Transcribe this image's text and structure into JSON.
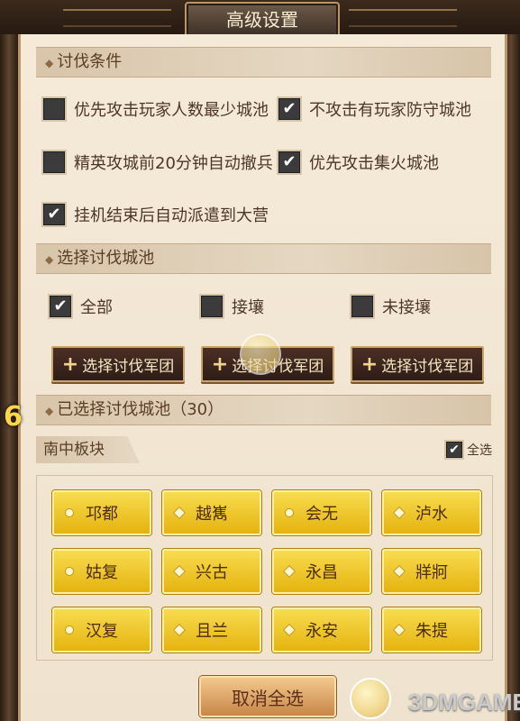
{
  "title": "高级设置",
  "sections": {
    "attack_conditions": "讨伐条件",
    "select_cities": "选择讨伐城池",
    "selected_cities": "已选择讨伐城池（30）"
  },
  "options": {
    "priority_fewest_players": {
      "label": "优先攻击玩家人数最少城池",
      "checked": false
    },
    "no_player_defended": {
      "label": "不攻击有玩家防守城池",
      "checked": true
    },
    "elite_auto_withdraw": {
      "label": "精英攻城前20分钟自动撤兵",
      "checked": false
    },
    "priority_focus_fire": {
      "label": "优先攻击集火城池",
      "checked": true
    },
    "auto_send_to_camp": {
      "label": "挂机结束后自动派遣到大营",
      "checked": true
    }
  },
  "city_filters": [
    {
      "label": "全部",
      "checked": true
    },
    {
      "label": "接壤",
      "checked": false
    },
    {
      "label": "未接壤",
      "checked": false
    }
  ],
  "army_button_label": "选择讨伐军团",
  "block": {
    "name": "南中板块",
    "select_all_label": "全选",
    "select_all_checked": true
  },
  "cities": [
    {
      "name": "邛都",
      "marker": "dot"
    },
    {
      "name": "越嶲",
      "marker": "gem"
    },
    {
      "name": "会无",
      "marker": "dot"
    },
    {
      "name": "泸水",
      "marker": "gem"
    },
    {
      "name": "姑复",
      "marker": "dot"
    },
    {
      "name": "兴古",
      "marker": "gem"
    },
    {
      "name": "永昌",
      "marker": "gem"
    },
    {
      "name": "牂牁",
      "marker": "gem"
    },
    {
      "name": "汉复",
      "marker": "dot"
    },
    {
      "name": "且兰",
      "marker": "gem"
    },
    {
      "name": "永安",
      "marker": "gem"
    },
    {
      "name": "朱提",
      "marker": "gem"
    }
  ],
  "cancel_all_label": "取消全选",
  "side_badge": "6",
  "watermark": "3DMGAME",
  "colors": {
    "gold_button": "#f2c21f",
    "dark_button": "#3a241c",
    "panel_bg": "#f2e6d4"
  }
}
